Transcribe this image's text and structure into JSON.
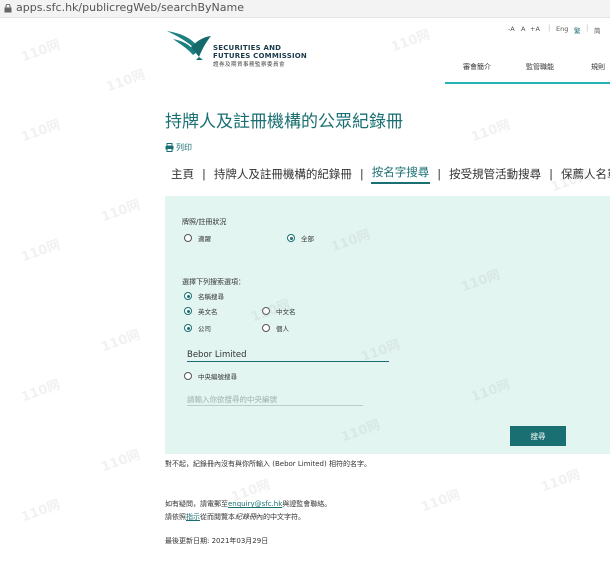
{
  "browser": {
    "url": "apps.sfc.hk/publicregWeb/searchByName"
  },
  "header": {
    "logo_en_1": "SECURITIES AND",
    "logo_en_2": "FUTURES COMMISSION",
    "logo_zh": "證券及期貨事務監察委員會",
    "font_small": "-A",
    "font_mid": "A",
    "font_large": "+A",
    "lang_en": "Eng",
    "lang_tc": "繁",
    "lang_sc": "简",
    "nav": [
      "審會簡介",
      "監管職能",
      "規則"
    ]
  },
  "page": {
    "title": "持牌人及註冊機構的公眾紀錄冊",
    "print_label": "列印",
    "tabs": [
      "主頁",
      "持牌人及註冊機構的紀錄冊",
      "按名字搜尋",
      "按受規管活動搜尋",
      "保薦人名單"
    ],
    "active_tab": 2
  },
  "form": {
    "status_label": "牌照/註冊狀況",
    "status_options": [
      "適躍",
      "全部"
    ],
    "status_selected": 1,
    "search_option_label": "選擇下列搜索選項：",
    "by_name": "名稱搜尋",
    "name_lang_options": [
      "英文名",
      "中文名"
    ],
    "name_lang_selected": 0,
    "entity_options": [
      "公司",
      "個人"
    ],
    "entity_selected": 0,
    "name_value": "Bebor Limited",
    "by_ce": "中央編號搜尋",
    "ce_placeholder": "請輸入你欲搜尋的中央編號",
    "search_button": "搜尋"
  },
  "messages": {
    "no_result": "對不起，紀錄冊內沒有與你所輸入 (Bebor Limited) 相符的名字。",
    "contact_pre": "如有疑問，請電郵至",
    "contact_email": "enquiry@sfc.hk",
    "contact_post": "與證監會聯絡。",
    "hint_pre": "請依照",
    "hint_link": "指示",
    "hint_mid": "從而閱覽本",
    "hint_italic": "紀錄冊",
    "hint_post": "內的中文字符。",
    "last_updated": "最後更新日期: 2021年03月29日"
  },
  "watermark": "110网",
  "colors": {
    "brand": "#1a6f72",
    "accent": "#25b3b1",
    "panel": "#e2f5f1"
  }
}
